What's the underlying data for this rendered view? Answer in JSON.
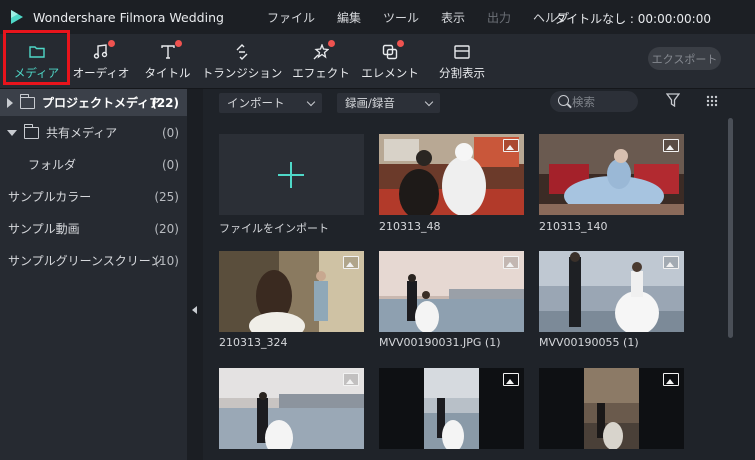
{
  "app": {
    "title": "Wondershare Filmora Wedding",
    "project_title": "タイトルなし : 00:00:00:00"
  },
  "menu": [
    {
      "label": "ファイル",
      "enabled": true
    },
    {
      "label": "編集",
      "enabled": true
    },
    {
      "label": "ツール",
      "enabled": true
    },
    {
      "label": "表示",
      "enabled": true
    },
    {
      "label": "出力",
      "enabled": false
    },
    {
      "label": "ヘルプ",
      "enabled": true
    }
  ],
  "toolbar": {
    "tabs": [
      {
        "label": "メディア",
        "icon": "folder-icon",
        "active": true,
        "badge": false
      },
      {
        "label": "オーディオ",
        "icon": "music-note-icon",
        "active": false,
        "badge": true
      },
      {
        "label": "タイトル",
        "icon": "text-icon",
        "active": false,
        "badge": true
      },
      {
        "label": "トランジション",
        "icon": "transition-icon",
        "active": false,
        "badge": false
      },
      {
        "label": "エフェクト",
        "icon": "effects-icon",
        "active": false,
        "badge": true
      },
      {
        "label": "エレメント",
        "icon": "elements-icon",
        "active": false,
        "badge": true
      },
      {
        "label": "分割表示",
        "icon": "split-screen-icon",
        "active": false,
        "badge": false
      }
    ],
    "export_label": "エクスポート"
  },
  "sidebar": {
    "items": [
      {
        "label": "プロジェクトメディア",
        "count": "(22)",
        "selected": true
      },
      {
        "label": "共有メディア",
        "count": "(0)",
        "selected": false
      },
      {
        "label": "フォルダ",
        "count": "(0)",
        "selected": false
      },
      {
        "label": "サンプルカラー",
        "count": "(25)",
        "selected": false
      },
      {
        "label": "サンプル動画",
        "count": "(20)",
        "selected": false
      },
      {
        "label": "サンプルグリーンスクリーン",
        "count": "(10)",
        "selected": false
      }
    ]
  },
  "filters": {
    "import_label": "インポート",
    "record_label": "録画/録音",
    "search_placeholder": "検索"
  },
  "media": {
    "import_tile_label": "ファイルをインポート",
    "items": [
      {
        "name": "210313_48"
      },
      {
        "name": "210313_140"
      },
      {
        "name": "210313_324"
      },
      {
        "name": "MVV00190031.JPG (1)"
      },
      {
        "name": "MVV00190055 (1)"
      },
      {
        "name": ""
      },
      {
        "name": ""
      },
      {
        "name": ""
      }
    ]
  },
  "colors": {
    "accent": "#4fd8c8",
    "highlight": "#e8141c",
    "badge": "#ef5350"
  }
}
